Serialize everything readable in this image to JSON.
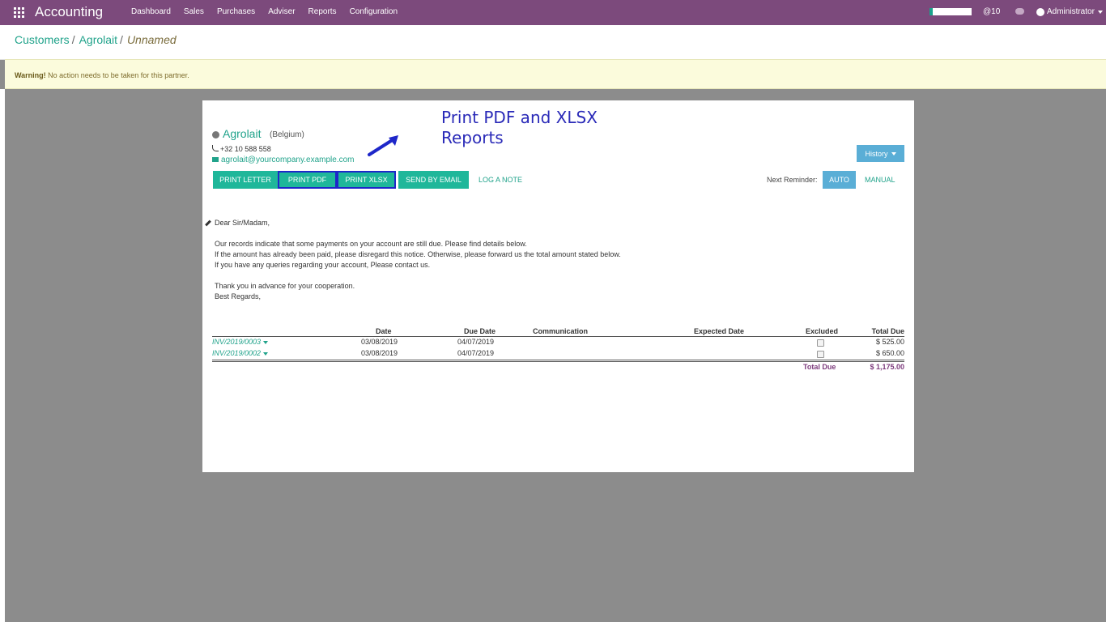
{
  "topbar": {
    "app_title": "Accounting",
    "menu": [
      "Dashboard",
      "Sales",
      "Purchases",
      "Adviser",
      "Reports",
      "Configuration"
    ],
    "notifications": "@10",
    "user": "Administrator",
    "bar_color": "#7c4a7c"
  },
  "breadcrumb": {
    "items": [
      "Customers",
      "Agrolait"
    ],
    "current": "Unnamed"
  },
  "warning": {
    "strong": "Warning!",
    "text": " No action needs to be taken for this partner."
  },
  "partner": {
    "name": "Agrolait",
    "country": "(Belgium)",
    "phone": "+32 10 588 558",
    "email": "agrolait@yourcompany.example.com"
  },
  "annotation": {
    "line1": "Print PDF and XLSX",
    "line2": "Reports"
  },
  "actions": {
    "print_letter": "PRINT LETTER",
    "print_pdf": "PRINT PDF",
    "print_xlsx": "PRINT XLSX",
    "send_email": "SEND BY EMAIL",
    "log_note": "LOG A NOTE",
    "history": "History",
    "next_reminder": "Next Reminder:",
    "auto": "AUTO",
    "manual": "MANUAL"
  },
  "letter": {
    "greeting": "Dear Sir/Madam,",
    "p1": "Our records indicate that some payments on your account are still due. Please find details below.",
    "p2": "If the amount has already been paid, please disregard this notice. Otherwise, please forward us the total amount stated below.",
    "p3": "If you have any queries regarding your account, Please contact us.",
    "p4": "Thank you in advance for your cooperation.",
    "p5": "Best Regards,"
  },
  "table": {
    "headers": {
      "date": "Date",
      "due_date": "Due Date",
      "communication": "Communication",
      "expected_date": "Expected Date",
      "excluded": "Excluded",
      "total_due": "Total Due"
    },
    "rows": [
      {
        "ref": "INV/2019/0003",
        "date": "03/08/2019",
        "due": "04/07/2019",
        "total": "$ 525.00"
      },
      {
        "ref": "INV/2019/0002",
        "date": "03/08/2019",
        "due": "04/07/2019",
        "total": "$ 650.00"
      }
    ],
    "total_label": "Total Due",
    "total_amount": "$ 1,175.00"
  }
}
